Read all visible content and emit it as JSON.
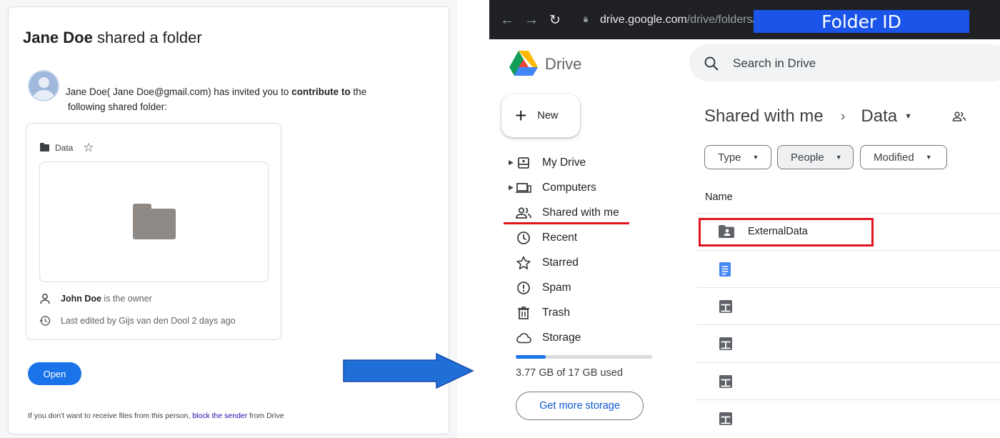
{
  "email": {
    "sender_name": "Jane Doe",
    "title_suffix": " shared a folder",
    "invite": {
      "name": "Jane Doe",
      "open_paren": "( ",
      "email_name": "Jane Doe",
      "email_domain": "@gmail.com) has invited you to ",
      "bold_action": "contribute to",
      "after_bold": " the",
      "line2": "following shared folder:"
    },
    "folder_name": "Data",
    "owner_name": "John Doe",
    "owner_suffix": " is the owner",
    "last_edited": "Last edited by Gijs van den Dool 2 days ago",
    "open_label": "Open",
    "footer_before": "If you don't want to receive files from this person, ",
    "footer_link": "block the sender",
    "footer_after": " from Drive"
  },
  "browser": {
    "url_main": "drive.google.com",
    "url_path": "/drive/folders/",
    "folder_id_label": "Folder ID"
  },
  "drive": {
    "app_name": "Drive",
    "search_placeholder": "Search in Drive",
    "new_label": "New",
    "nav": [
      {
        "label": "My Drive",
        "icon": "my-drive-icon",
        "has_caret": true
      },
      {
        "label": "Computers",
        "icon": "computers-icon",
        "has_caret": true
      },
      {
        "label": "Shared with me",
        "icon": "shared-people-icon",
        "has_caret": false
      },
      {
        "label": "Recent",
        "icon": "clock-icon",
        "has_caret": false
      },
      {
        "label": "Starred",
        "icon": "star-icon",
        "has_caret": false
      },
      {
        "label": "Spam",
        "icon": "spam-icon",
        "has_caret": false
      },
      {
        "label": "Trash",
        "icon": "trash-icon",
        "has_caret": false
      },
      {
        "label": "Storage",
        "icon": "cloud-icon",
        "has_caret": false
      }
    ],
    "storage_used_fraction": 0.22,
    "storage_text": "3.77 GB of 17 GB used",
    "more_storage_label": "Get more storage",
    "breadcrumb": {
      "root": "Shared with me",
      "current": "Data"
    },
    "filters": [
      "Type",
      "People",
      "Modified"
    ],
    "column_name": "Name",
    "files": [
      {
        "name": "ExternalData",
        "icon": "shared-folder-icon"
      },
      {
        "name": "",
        "icon": "docs-icon"
      },
      {
        "name": "",
        "icon": "sheets-icon"
      },
      {
        "name": "",
        "icon": "sheets-icon"
      },
      {
        "name": "",
        "icon": "sheets-icon"
      },
      {
        "name": "",
        "icon": "sheets-icon"
      }
    ]
  },
  "colors": {
    "accent_blue": "#1a73e8",
    "highlight_red": "#e0141d",
    "folder_id_blue": "#1a54e8",
    "arrow_blue": "#1f6fd6"
  }
}
